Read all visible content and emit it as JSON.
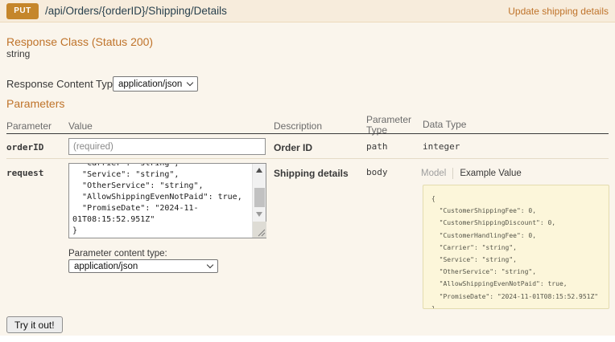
{
  "header": {
    "method": "PUT",
    "path": "/api/Orders/{orderID}/Shipping/Details",
    "link_label": "Update shipping details"
  },
  "response_class": {
    "title": "Response Class (Status 200)",
    "return_type": "string",
    "content_type_label": "Response Content Type",
    "content_type_value": "application/json"
  },
  "parameters": {
    "title": "Parameters",
    "columns": [
      "Parameter",
      "Value",
      "Description",
      "Parameter Type",
      "Data Type"
    ],
    "rows": [
      {
        "name": "orderID",
        "placeholder": "(required)",
        "description": "Order ID",
        "param_type": "path",
        "data_type": "integer"
      },
      {
        "name": "request",
        "value_visible": "  \"Carrier\": \"string\",\n  \"Service\": \"string\",\n  \"OtherService\": \"string\",\n  \"AllowShippingEvenNotPaid\": true,\n  \"PromiseDate\": \"2024-11-01T08:15:52.951Z\"\n}",
        "description": "Shipping details",
        "param_type": "body",
        "content_type_label": "Parameter content type:",
        "content_type_value": "application/json",
        "tabs": {
          "model": "Model",
          "example": "Example Value"
        },
        "example_value": "{\n  \"CustomerShippingFee\": 0,\n  \"CustomerShippingDiscount\": 0,\n  \"CustomerHandlingFee\": 0,\n  \"Carrier\": \"string\",\n  \"Service\": \"string\",\n  \"OtherService\": \"string\",\n  \"AllowShippingEvenNotPaid\": true,\n  \"PromiseDate\": \"2024-11-01T08:15:52.951Z\"\n}"
      }
    ]
  },
  "actions": {
    "try_it_out": "Try it out!"
  },
  "icons": {
    "select_chevron": "chevron-down-icon",
    "scroll_up": "triangle-up-icon",
    "scroll_down": "triangle-down-icon",
    "resize_grip": "resize-grip-icon"
  },
  "colors": {
    "accent_orange": "#bf732a",
    "method_badge": "#c5862b",
    "header_bar_bg": "#f7ecdc",
    "content_bg": "#faf5ec",
    "example_bg": "#fcf6da"
  }
}
